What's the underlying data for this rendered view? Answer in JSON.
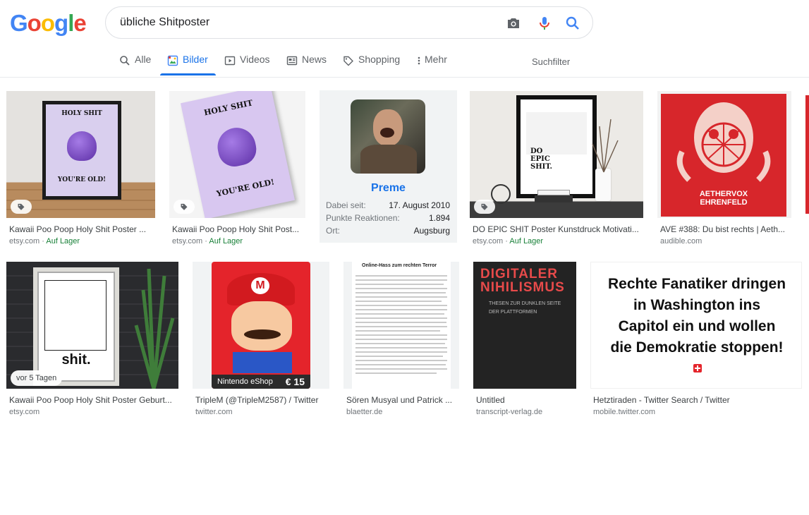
{
  "search": {
    "query": "übliche Shitposter"
  },
  "logo": [
    "G",
    "o",
    "o",
    "g",
    "l",
    "e"
  ],
  "tabs": [
    {
      "label": "Alle"
    },
    {
      "label": "Bilder"
    },
    {
      "label": "Videos"
    },
    {
      "label": "News"
    },
    {
      "label": "Shopping"
    },
    {
      "label": "Mehr"
    }
  ],
  "tools_label": "Suchfilter",
  "results": [
    {
      "title": "Kawaii Poo Poop Holy Shit Poster ...",
      "source": "etsy.com",
      "stock": "Auf Lager",
      "poster_top": "HOLY SHIT",
      "poster_bottom": "YOU'RE OLD!"
    },
    {
      "title": "Kawaii Poo Poop Holy Shit Post...",
      "source": "etsy.com",
      "stock": "Auf Lager",
      "poster_top": "HOLY SHIT",
      "poster_bottom": "YOU'RE OLD!"
    },
    {
      "title": "DO EPIC SHIT Poster Kunstdruck Motivati...",
      "source": "etsy.com",
      "stock": "Auf Lager",
      "poster_text": [
        "DO",
        "EPIC",
        "SHIT."
      ]
    },
    {
      "title": "AVE #388: Du bist rechts | Aeth...",
      "source": "audible.com",
      "poster_text": [
        "AETHERVOX",
        "EHRENFELD"
      ]
    },
    {
      "title": "Kawaii Poo Poop Holy Shit Poster Geburt...",
      "source": "etsy.com",
      "badge": "vor 5 Tagen",
      "poster_text": "shit."
    },
    {
      "title": "TripleM (@TripleM2587) / Twitter",
      "source": "twitter.com",
      "poster_text": "Nintendo eShop",
      "price": "€ 15"
    },
    {
      "title": "Sören Musyal und Patrick ...",
      "source": "blaetter.de",
      "doc_title": "Online-Hass zum rechten Terror"
    },
    {
      "title": "Untitled",
      "source": "transcript-verlag.de",
      "book_title": [
        "DIGITALER",
        "NIHILISMUS"
      ],
      "book_sub": [
        "THESEN ZUR DUNKLEN SEITE",
        "DER PLATTFORMEN"
      ]
    },
    {
      "title": "Hetztiraden - Twitter Search / Twitter",
      "source": "mobile.twitter.com",
      "headline": [
        "Rechte Fanatiker dringen",
        "in Washington ins",
        "Capitol ein und wollen",
        "die Demokratie stoppen!"
      ]
    }
  ],
  "profile": {
    "name": "Preme",
    "rows": [
      {
        "label": "Dabei seit:",
        "value": "17. August 2010"
      },
      {
        "label": "Punkte Reaktionen:",
        "value": "1.894"
      },
      {
        "label": "Ort:",
        "value": "Augsburg"
      }
    ]
  }
}
